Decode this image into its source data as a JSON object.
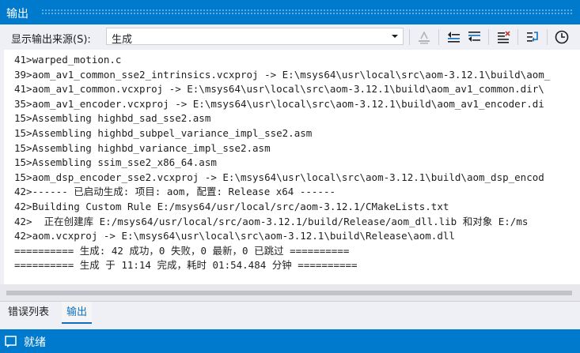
{
  "panel": {
    "title": "输出"
  },
  "toolbar": {
    "source_label": "显示输出来源(S):",
    "source_value": "生成",
    "buttons": [
      {
        "name": "find-message-icon"
      },
      {
        "name": "prev-message-icon"
      },
      {
        "name": "next-message-icon"
      },
      {
        "name": "clear-all-icon"
      },
      {
        "name": "word-wrap-icon"
      },
      {
        "name": "show-timestamps-icon"
      }
    ]
  },
  "output_lines": [
    "41>warped_motion.c",
    "39>aom_av1_common_sse2_intrinsics.vcxproj -> E:\\msys64\\usr\\local\\src\\aom-3.12.1\\build\\aom_",
    "41>aom_av1_common.vcxproj -> E:\\msys64\\usr\\local\\src\\aom-3.12.1\\build\\aom_av1_common.dir\\",
    "35>aom_av1_encoder.vcxproj -> E:\\msys64\\usr\\local\\src\\aom-3.12.1\\build\\aom_av1_encoder.di",
    "15>Assembling highbd_sad_sse2.asm",
    "15>Assembling highbd_subpel_variance_impl_sse2.asm",
    "15>Assembling highbd_variance_impl_sse2.asm",
    "15>Assembling ssim_sse2_x86_64.asm",
    "15>aom_dsp_encoder_sse2.vcxproj -> E:\\msys64\\usr\\local\\src\\aom-3.12.1\\build\\aom_dsp_encod",
    "42>------ 已启动生成: 项目: aom, 配置: Release x64 ------",
    "42>Building Custom Rule E:/msys64/usr/local/src/aom-3.12.1/CMakeLists.txt",
    "42>  正在创建库 E:/msys64/usr/local/src/aom-3.12.1/build/Release/aom_dll.lib 和对象 E:/ms",
    "42>aom.vcxproj -> E:\\msys64\\usr\\local\\src\\aom-3.12.1\\build\\Release\\aom.dll",
    "========== 生成: 42 成功，0 失败，0 最新，0 已跳过 ==========",
    "========== 生成 于 11:14 完成，耗时 01:54.484 分钟 =========="
  ],
  "tabs": [
    {
      "label": "错误列表",
      "active": false
    },
    {
      "label": "输出",
      "active": true
    }
  ],
  "status": {
    "text": "就绪"
  },
  "colors": {
    "accent": "#007acc",
    "tab_active": "#0e70c0"
  }
}
